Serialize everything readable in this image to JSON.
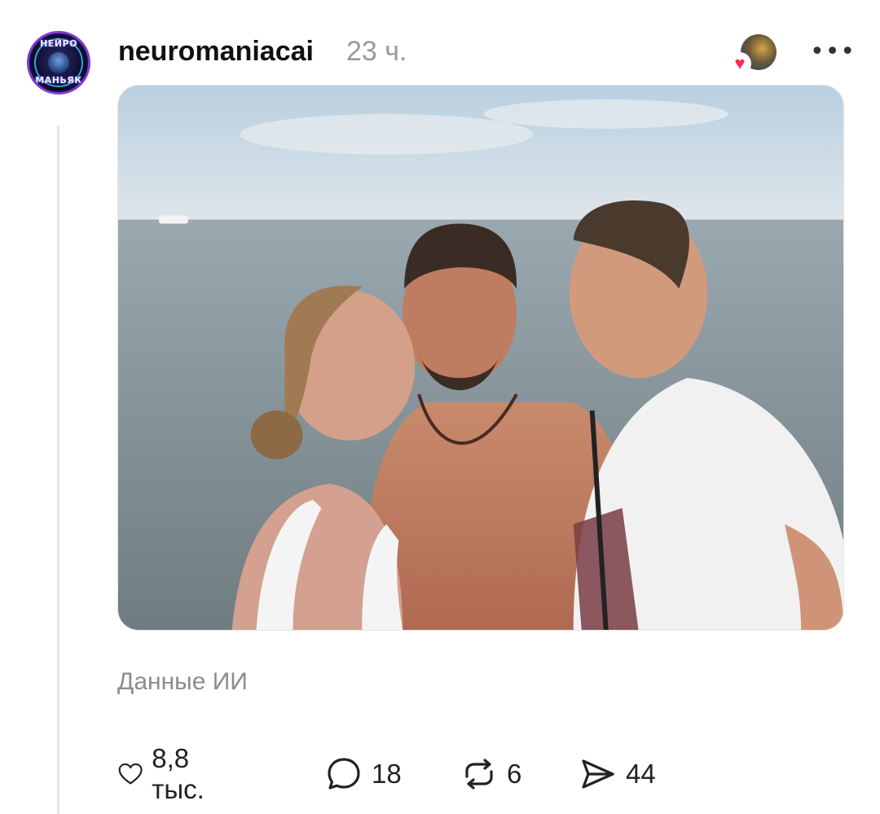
{
  "post": {
    "author": {
      "username": "neuromaniacai",
      "avatar_text_top": "НЕЙРО",
      "avatar_text_bottom": "МАНЬЯК"
    },
    "time": "23 ч.",
    "more_label": "•••",
    "caption": "Данные ИИ",
    "actions": {
      "likes": "8,8 тыс.",
      "replies": "18",
      "reposts": "6",
      "shares": "44"
    }
  },
  "icons": {
    "like": "heart-icon",
    "reply": "speech-bubble-icon",
    "repost": "repost-arrows-icon",
    "share": "paper-plane-icon",
    "more": "ellipsis-icon",
    "liker_heart": "red-heart-icon"
  },
  "colors": {
    "text_primary": "#111111",
    "text_secondary": "#9a9a9a",
    "like_heart": "#ff2d4f",
    "thread_line": "#e5e5e5"
  }
}
